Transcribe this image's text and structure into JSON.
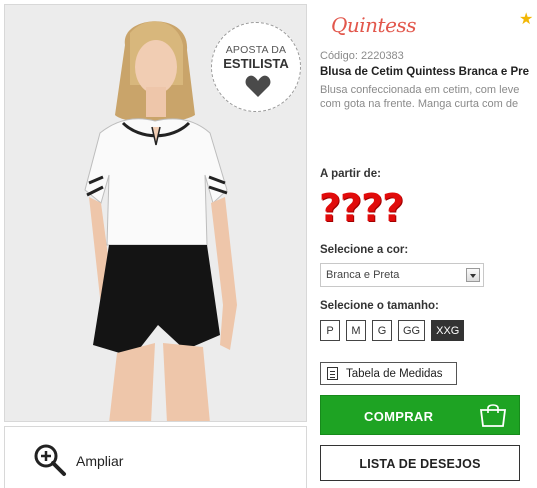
{
  "product": {
    "brand": "Quintess",
    "sku": "Código: 2220383",
    "title": "Blusa de Cetim Quintess Branca e Pre",
    "description_line1": "Blusa confeccionada em cetim, com leve",
    "description_line2": "com gota na frente. Manga curta com de",
    "badge_line1": "APOSTA DA",
    "badge_line2": "ESTILISTA"
  },
  "gallery": {
    "zoom_label": "Ampliar"
  },
  "pricing": {
    "label": "A partir de:",
    "value": "????"
  },
  "options": {
    "color_label": "Selecione a cor:",
    "color_selected": "Branca e Preta",
    "size_label": "Selecione o tamanho:",
    "sizes": [
      "P",
      "M",
      "G",
      "GG",
      "XXG"
    ],
    "size_selected": "XXG",
    "measure_table_label": "Tabela de Medidas"
  },
  "actions": {
    "buy_label": "COMPRAR",
    "wishlist_label": "LISTA DE DESEJOS"
  },
  "icons": {
    "favorite": "star-icon",
    "zoom": "zoom-in-icon",
    "measure": "document-icon",
    "bag": "shopping-bag-icon",
    "badge": "heart-icon"
  },
  "colors": {
    "brand": "#e2574c",
    "price": "#e10b0b",
    "buy_button": "#1ea323",
    "star": "#f2b705",
    "size_active": "#333333"
  }
}
